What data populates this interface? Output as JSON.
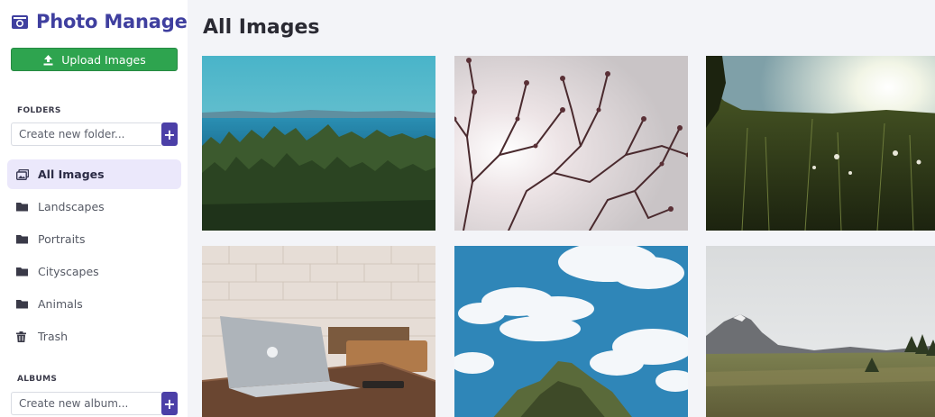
{
  "app": {
    "title": "Photo Manager"
  },
  "sidebar": {
    "upload_label": "Upload Images",
    "folders_label": "FOLDERS",
    "folder_placeholder": "Create new folder...",
    "albums_label": "ALBUMS",
    "album_placeholder": "Create new album...",
    "items": [
      {
        "label": "All Images",
        "icon": "images-icon",
        "active": true
      },
      {
        "label": "Landscapes",
        "icon": "folder-icon"
      },
      {
        "label": "Portraits",
        "icon": "folder-icon"
      },
      {
        "label": "Cityscapes",
        "icon": "folder-icon"
      },
      {
        "label": "Animals",
        "icon": "folder-icon"
      },
      {
        "label": "Trash",
        "icon": "trash-icon"
      }
    ]
  },
  "main": {
    "title": "All Images",
    "images": [
      {
        "subject": "coastal-forest"
      },
      {
        "subject": "branches-against-sun"
      },
      {
        "subject": "sunlit-meadow"
      },
      {
        "subject": "laptop-on-desk"
      },
      {
        "subject": "clouds-over-rock"
      },
      {
        "subject": "mountain-valley"
      }
    ]
  },
  "colors": {
    "accent": "#4b3fa7",
    "brand": "#3f3f9f",
    "upload": "#2ea44f",
    "active_bg": "#ebe8fb"
  }
}
